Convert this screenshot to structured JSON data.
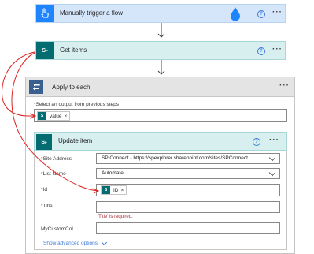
{
  "trigger": {
    "title": "Manually trigger a flow",
    "help": "?",
    "more": "···"
  },
  "get_items": {
    "title": "Get items",
    "help": "?",
    "more": "···"
  },
  "apply_each": {
    "title": "Apply to each",
    "more": "···",
    "select_label": "Select an output from previous steps",
    "token_label": "value",
    "token_remove": "×"
  },
  "update_item": {
    "title": "Update item",
    "help": "?",
    "more": "···",
    "site_address_label": "Site Address",
    "site_address_value": "SP Connect - https://spexplorer.sharepoint.com/sites/SPConnect",
    "list_name_label": "List Name",
    "list_name_value": "Automate",
    "id_label": "Id",
    "id_token": "ID",
    "id_remove": "×",
    "title_label": "Title",
    "title_error": "'Title' is required.",
    "custom_label": "MyCustomCol",
    "show_advanced": "Show advanced options"
  },
  "colors": {
    "trigger_bg": "#d5e6fb",
    "trigger_icon": "#1f85ff",
    "sp_icon": "#036c70",
    "get_items_bg": "#d7efef",
    "apply_bg": "#e4e4e4",
    "apply_icon": "#3b5f8f",
    "arrow": "#dd2222",
    "error": "#a4262c"
  },
  "icons": [
    "touch-hand-icon",
    "sharepoint-icon",
    "loop-icon",
    "help-icon",
    "more-icon",
    "chevron-down-icon",
    "water-drop-icon",
    "down-arrow-icon"
  ]
}
